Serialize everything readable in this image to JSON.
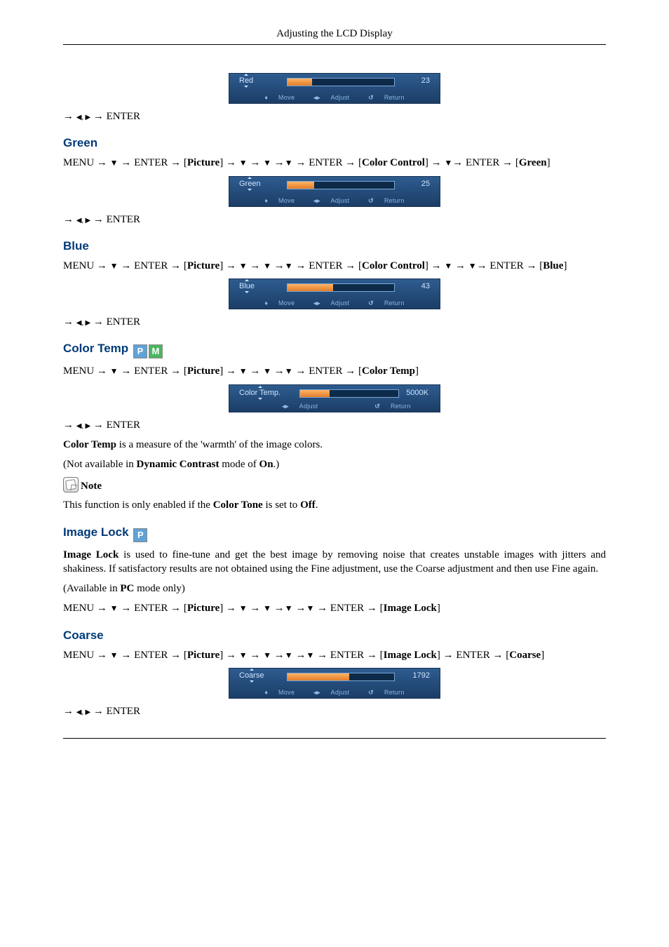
{
  "header": "Adjusting the LCD Display",
  "arrows": {
    "down": "▼",
    "left_right": "◀, ▶",
    "rarr": "→"
  },
  "keys": {
    "menu": "MENU",
    "enter": "ENTER"
  },
  "labels": {
    "picture": "Picture",
    "color_control": "Color Control",
    "color_temp": "Color Temp",
    "image_lock": "Image Lock",
    "green": "Green",
    "blue": "Blue",
    "coarse": "Coarse"
  },
  "osd": {
    "hints": {
      "move": "Move",
      "adjust": "Adjust",
      "return": "Return"
    },
    "red": {
      "label": "Red",
      "value": "23",
      "fill": 23
    },
    "green": {
      "label": "Green",
      "value": "25",
      "fill": 25
    },
    "blue": {
      "label": "Blue",
      "value": "43",
      "fill": 43
    },
    "temp": {
      "label": "Color Temp.",
      "value": "5000K",
      "fill": 30
    },
    "coarse": {
      "label": "Coarse",
      "value": "1792",
      "fill": 58
    }
  },
  "sections": {
    "green_title": "Green",
    "blue_title": "Blue",
    "color_temp_title": "Color Temp",
    "image_lock_title": "Image Lock",
    "coarse_title": "Coarse"
  },
  "text": {
    "color_temp_desc_pre": "Color Temp",
    "color_temp_desc_post": " is a measure of the 'warmth' of the image colors.",
    "not_avail_pre": "(Not available in ",
    "dyn_contrast": "Dynamic Contrast",
    "not_avail_mid": " mode of ",
    "on": "On",
    "not_avail_post": ".)",
    "note": "Note",
    "ct_enabled_pre": "This function is only enabled if the ",
    "color_tone": "Color Tone",
    "ct_enabled_mid": " is set to ",
    "off": "Off",
    "ct_enabled_post": ".",
    "image_lock_desc_pre": "Image Lock",
    "image_lock_desc": " is used to fine-tune and get the best image by removing noise that creates unstable images with jitters and shakiness. If satisfactory results are not obtained using the Fine adjustment, use the Coarse adjustment and then use Fine again.",
    "pc_only_pre": "(Available in ",
    "pc": "PC",
    "pc_only_post": " mode only)"
  }
}
